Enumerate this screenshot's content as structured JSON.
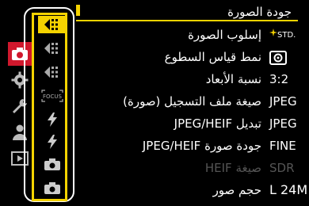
{
  "header": {
    "title": "جودة الصورة"
  },
  "settings": [
    {
      "label": "إسلوب الصورة",
      "value": "STD.",
      "disabled": false
    },
    {
      "label": "نمط قياس السطوع",
      "value": "",
      "disabled": false
    },
    {
      "label": "نسبة الأبعاد",
      "value": "3:2",
      "disabled": false
    },
    {
      "label": "صيغة ملف التسجيل (صورة)",
      "value": "JPEG",
      "disabled": false
    },
    {
      "label": "تبديل JPEG/HEIF",
      "value": "JPEG",
      "disabled": false
    },
    {
      "label": "جودة صورة JPEG/HEIF",
      "value": "FINE",
      "disabled": false
    },
    {
      "label": "صيغة HEIF",
      "value": "SDR",
      "disabled": true
    },
    {
      "label": "حجم صور",
      "value": "L 24M",
      "disabled": false
    }
  ],
  "left_tabs": [
    {
      "name": "camera-tab-icon",
      "active": true
    },
    {
      "name": "gear-tab-icon",
      "active": false
    },
    {
      "name": "wrench-tab-icon",
      "active": false
    },
    {
      "name": "person-tab-icon",
      "active": false
    },
    {
      "name": "playback-tab-icon",
      "active": false
    }
  ],
  "icon_column": [
    {
      "name": "photo-style-icon",
      "selected": true
    },
    {
      "name": "photo-style-icon-2",
      "selected": false
    },
    {
      "name": "photo-style-icon-3",
      "selected": false
    },
    {
      "name": "focus-icon",
      "selected": false
    },
    {
      "name": "flash-icon",
      "selected": false
    },
    {
      "name": "flash-icon-2",
      "selected": false
    },
    {
      "name": "camera-icon",
      "selected": false
    },
    {
      "name": "camera-icon-2",
      "selected": false
    }
  ],
  "icon_text": {
    "focus": "FOCUS"
  },
  "colors": {
    "accent": "#f5d300",
    "active_tab": "#d0182d",
    "disabled": "#555555"
  }
}
